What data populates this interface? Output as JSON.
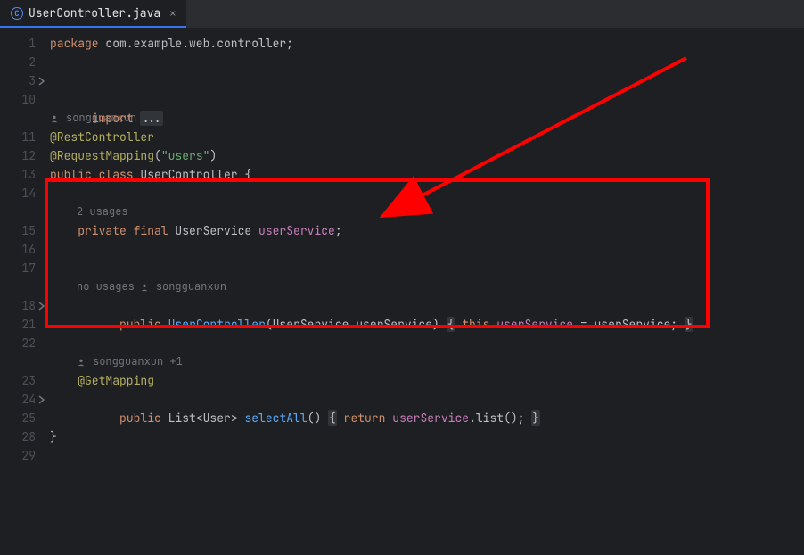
{
  "tab": {
    "icon": "C",
    "filename": "UserController.java"
  },
  "gutter": [
    "1",
    "2",
    "3",
    "10",
    "",
    "11",
    "12",
    "13",
    "14",
    "",
    "15",
    "16",
    "17",
    "",
    "18",
    "21",
    "22",
    "",
    "23",
    "24",
    "25",
    "28",
    "29"
  ],
  "code": {
    "package_kw": "package",
    "package_name": " com.example.web.controller;",
    "import_kw": "import ",
    "import_ellipsis": "...",
    "author1": "songguanxun +1",
    "ann1": "@RestController",
    "ann2a": "@RequestMapping",
    "ann2b": "(",
    "ann2c": "\"users\"",
    "ann2d": ")",
    "class_mod": "public class ",
    "class_name": "UserController",
    "class_open": " {",
    "usages1": "2 usages",
    "field_mod": "private final ",
    "field_type": "UserService ",
    "field_name": "userService",
    "field_end": ";",
    "no_usages": "no usages",
    "author2": "songguanxun",
    "ctor_mod": "public ",
    "ctor_name": "UserController",
    "ctor_params1": "(UserService userService) ",
    "ctor_brace_l": "{",
    "ctor_this": " this",
    "ctor_dot": ".",
    "ctor_lhs": "userService",
    "ctor_eq": " = userService; ",
    "ctor_brace_r": "}",
    "author3": "songguanxun +1",
    "ann3": "@GetMapping",
    "m1_mod": "public ",
    "m1_type1": "List",
    "m1_type2": "<User> ",
    "m1_name": "selectAll",
    "m1_paren": "() ",
    "m1_brace_l": "{",
    "m1_ret": " return ",
    "m1_recv": "userService",
    "m1_call": ".list(); ",
    "m1_brace_r": "}",
    "class_close": "}"
  }
}
